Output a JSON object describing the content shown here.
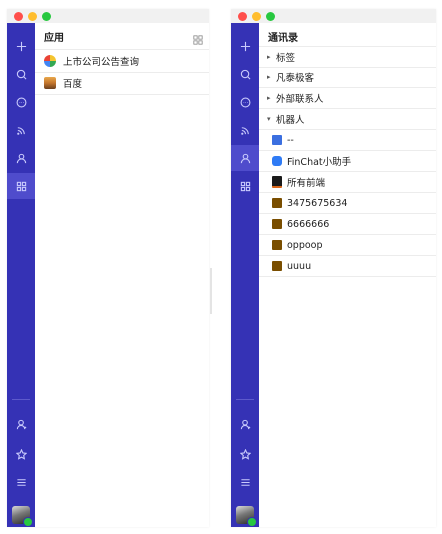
{
  "left_window": {
    "panel_title": "应用",
    "apps": [
      {
        "label": "上市公司公告查询",
        "icon": "pinwheel-icon"
      },
      {
        "label": "百度",
        "icon": "landscape-thumbnail-icon"
      }
    ]
  },
  "right_window": {
    "panel_title": "通讯录",
    "groups": [
      {
        "label": "标签",
        "expanded": false
      },
      {
        "label": "凡泰极客",
        "expanded": false
      },
      {
        "label": "外部联系人",
        "expanded": false
      },
      {
        "label": "机器人",
        "expanded": true
      }
    ],
    "robots": [
      {
        "label": "--",
        "color": "#3b6fe0"
      },
      {
        "label": "FinChat小助手",
        "color": "#2f7bf5"
      },
      {
        "label": "所有前端",
        "color": "#1a1a1a"
      },
      {
        "label": "3475675634",
        "color": "#7a4e00"
      },
      {
        "label": "6666666",
        "color": "#7a4e00"
      },
      {
        "label": "oppoop",
        "color": "#7a4e00"
      },
      {
        "label": "uuuu",
        "color": "#7a4e00"
      }
    ]
  },
  "sidebar": {
    "top_icons": [
      "add-icon",
      "search-icon",
      "chat-icon",
      "feed-icon",
      "contacts-icon",
      "apps-icon"
    ],
    "bottom_icons": [
      "profile-icon",
      "star-icon",
      "menu-icon"
    ],
    "accent_color": "#3532b5"
  }
}
